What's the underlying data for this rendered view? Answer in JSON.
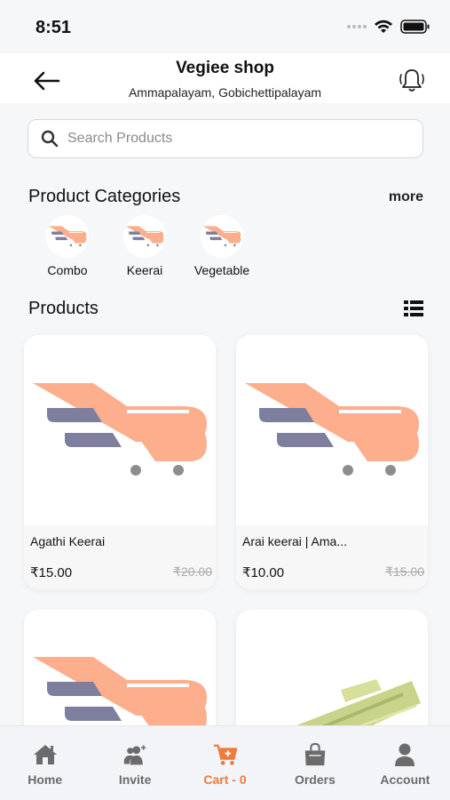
{
  "status": {
    "time": "8:51"
  },
  "header": {
    "title": "Vegiee shop",
    "subtitle": "Ammapalayam, Gobichettipalayam"
  },
  "search": {
    "placeholder": "Search Products",
    "value": ""
  },
  "categories_section": {
    "title": "Product Categories",
    "more_label": "more",
    "items": [
      {
        "label": "Combo",
        "icon": "cart-icon"
      },
      {
        "label": "Keerai",
        "icon": "cart-icon"
      },
      {
        "label": "Vegetable",
        "icon": "cart-icon"
      }
    ]
  },
  "products_section": {
    "title": "Products",
    "items": [
      {
        "name": "Agathi Keerai",
        "price": "₹15.00",
        "mrp": "₹20.00",
        "image": "cart-placeholder"
      },
      {
        "name": "Arai keerai | Ama...",
        "price": "₹10.00",
        "mrp": "₹15.00",
        "image": "cart-placeholder"
      },
      {
        "name": "",
        "price": "",
        "mrp": "",
        "image": "cart-placeholder"
      },
      {
        "name": "",
        "price": "",
        "mrp": "",
        "image": "vegetable-photo"
      }
    ]
  },
  "nav": {
    "items": [
      {
        "label": "Home",
        "icon": "home-icon",
        "active": false
      },
      {
        "label": "Invite",
        "icon": "invite-users-icon",
        "active": false
      },
      {
        "label": "Cart - 0",
        "icon": "cart-add-icon",
        "active": true
      },
      {
        "label": "Orders",
        "icon": "shopping-bag-icon",
        "active": false
      },
      {
        "label": "Account",
        "icon": "user-icon",
        "active": false
      }
    ]
  },
  "colors": {
    "accent": "#f07a3a",
    "cart_peach": "#fdae8c",
    "cart_lines": "#7e7f9f",
    "background": "#f6f7f9"
  }
}
